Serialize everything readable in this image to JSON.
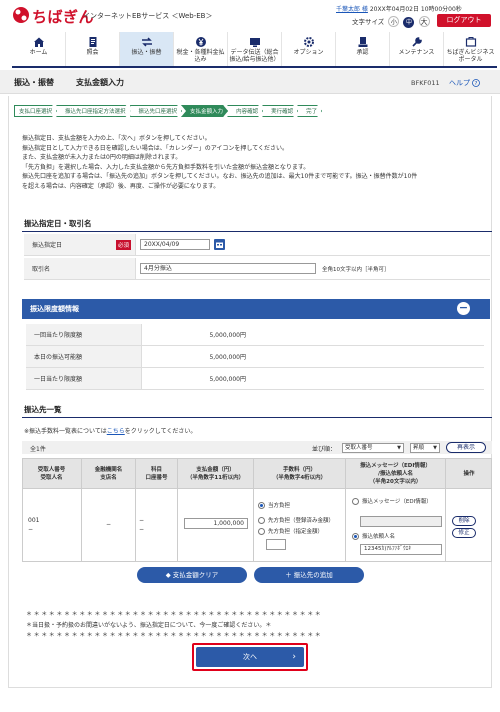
{
  "header": {
    "brand": "ちばぎん",
    "service": "インターネットEBサービス ＜Web-EB＞",
    "user_name": "千葉太郎 様",
    "login_time": "20XX年04月02日 10時00分00秒",
    "font_size_label": "文字サイズ",
    "font_small": "小",
    "font_mid": "中",
    "font_large": "大",
    "logout": "ログアウト"
  },
  "nav": {
    "items": [
      {
        "label": "ホーム",
        "icon": "home-icon"
      },
      {
        "label": "照会",
        "icon": "document-icon"
      },
      {
        "label": "振込・振替",
        "icon": "transfer-icon"
      },
      {
        "label": "税金・各種料金払込み",
        "icon": "yen-icon"
      },
      {
        "label": "データ伝送（総合振込/給与振込他）",
        "icon": "data-icon"
      },
      {
        "label": "オプション",
        "icon": "gear-icon"
      },
      {
        "label": "承認",
        "icon": "approve-icon"
      },
      {
        "label": "メンテナンス",
        "icon": "wrench-icon"
      },
      {
        "label": "ちばぎんビジネスポータル",
        "icon": "portal-icon"
      }
    ]
  },
  "title": {
    "main": "振込・振替",
    "sub": "支払金額入力",
    "code": "BFKF011",
    "help": "ヘルプ"
  },
  "steps": [
    "支払口座選択",
    "振込先口座指定方法選択",
    "振込先口座選択",
    "支払金額入力",
    "内容確認",
    "実行確認",
    "完了"
  ],
  "instructions": [
    "振込指定日、支払金額を入力の上、「次へ」ボタンを押してください。",
    "振込指定日として入力できる日を確認したい場合は、「カレンダー」のアイコンを押してください。",
    "また、支払金額が未入力または0円の明細は削除されます。",
    "「先方負担」を選択した場合、入力した支払金額から先方負担手数料を引いた金額が振込金額となります。",
    "振込先口座を追加する場合は、「振込先の追加」ボタンを押してください。なお、振込先の追加は、最大10件まで可能です。振込・振替件数が10件",
    "を超える場合は、内容確定（承認）後、再度、ご操作が必要になります。"
  ],
  "section_date": {
    "title": "振込指定日・取引名",
    "date_label": "振込指定日",
    "required": "必須",
    "date_value": "20XX/04/09",
    "name_label": "取引名",
    "name_value": "4月分振込",
    "name_hint": "全角10文字以内［半角可］"
  },
  "section_limit": {
    "title": "振込限度額情報",
    "toggle": "−",
    "rows": [
      {
        "label": "一回当たり限度額",
        "value": "5,000,000円"
      },
      {
        "label": "本日の振込可能額",
        "value": "5,000,000円"
      },
      {
        "label": "一日当たり限度額",
        "value": "5,000,000円"
      }
    ]
  },
  "section_payees": {
    "title": "振込先一覧",
    "note_prefix": "※振込手数料一覧表については",
    "note_link": "こちら",
    "note_suffix": "をクリックしてください。",
    "count": "全1件",
    "sort_label": "並び順：",
    "sort_value": "受取人番号",
    "order_value": "昇順",
    "redisplay": "再表示",
    "headers": {
      "col1_line1": "受取人番号",
      "col1_line2": "受取人名",
      "col2_line1": "金融機関名",
      "col2_line2": "支店名",
      "col3_line1": "科目",
      "col3_line2": "口座番号",
      "col4_line1": "支払金額（円）",
      "col4_line2": "（半角数字11桁以内）",
      "col5_line1": "手数料（円）",
      "col5_line2": "（半角数字4桁以内）",
      "col6_line1": "振込メッセージ（EDI情報）",
      "col6_line2": "/振込依頼人名",
      "col6_line3": "（半角20文字以内）",
      "col7": "操作"
    },
    "row": {
      "number": "001",
      "name": "−",
      "bank": "−",
      "subject": "−",
      "account": "−",
      "amount": "1,000,000",
      "fee_opt1": "当方負担",
      "fee_opt2": "先方負担（登録済み金額）",
      "fee_opt3": "先方負担（指定金額）",
      "msg_opt1": "振込メッセージ（EDI情報）",
      "msg_opt2": "振込依頼人名",
      "requester": "12345ｶ)ｱﾙﾌｧﾎﾞｳｴｷ",
      "delete": "削除",
      "edit": "修正"
    },
    "clear_button": "支払金額クリア",
    "add_button": "振込先の追加"
  },
  "footer": {
    "stars": "＊＊＊＊＊＊＊＊＊＊＊＊＊＊＊＊＊＊＊＊＊＊＊＊＊＊＊＊＊＊＊＊＊＊＊＊＊＊＊",
    "confirm": "＊当日扱・予約扱のお間違いがないよう、振込指定日について、今一度ご確認ください。＊",
    "next": "次へ"
  },
  "colors": {
    "brand_red": "#d0112b",
    "navy": "#1a2c6b",
    "panel_blue": "#2c5aa8",
    "step_green": "#2f8a5a"
  }
}
